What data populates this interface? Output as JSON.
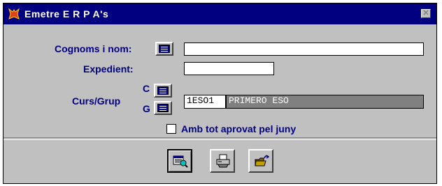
{
  "window": {
    "title": "Emetre E R P A's",
    "close_glyph": "✕"
  },
  "form": {
    "name_label": "Cognoms i nom:",
    "name_value": "",
    "expedient_label": "Expedient:",
    "expedient_value": "",
    "curs_label": "Curs/Grup",
    "c_label": "C",
    "g_label": "G",
    "group_code": "1ESO1",
    "group_name": "PRIMERO ESO",
    "checkbox_label": "Amb tot aprovat pel juny",
    "checkbox_checked": false
  },
  "toolbar": {
    "buttons": [
      {
        "name": "preview",
        "icon": "report-preview-icon"
      },
      {
        "name": "print",
        "icon": "printer-icon"
      },
      {
        "name": "exit",
        "icon": "exit-folder-icon"
      }
    ]
  },
  "colors": {
    "titlebar": "#000080",
    "label": "#000080",
    "window_bg": "#c0c0c0",
    "field_disabled": "#808080"
  }
}
